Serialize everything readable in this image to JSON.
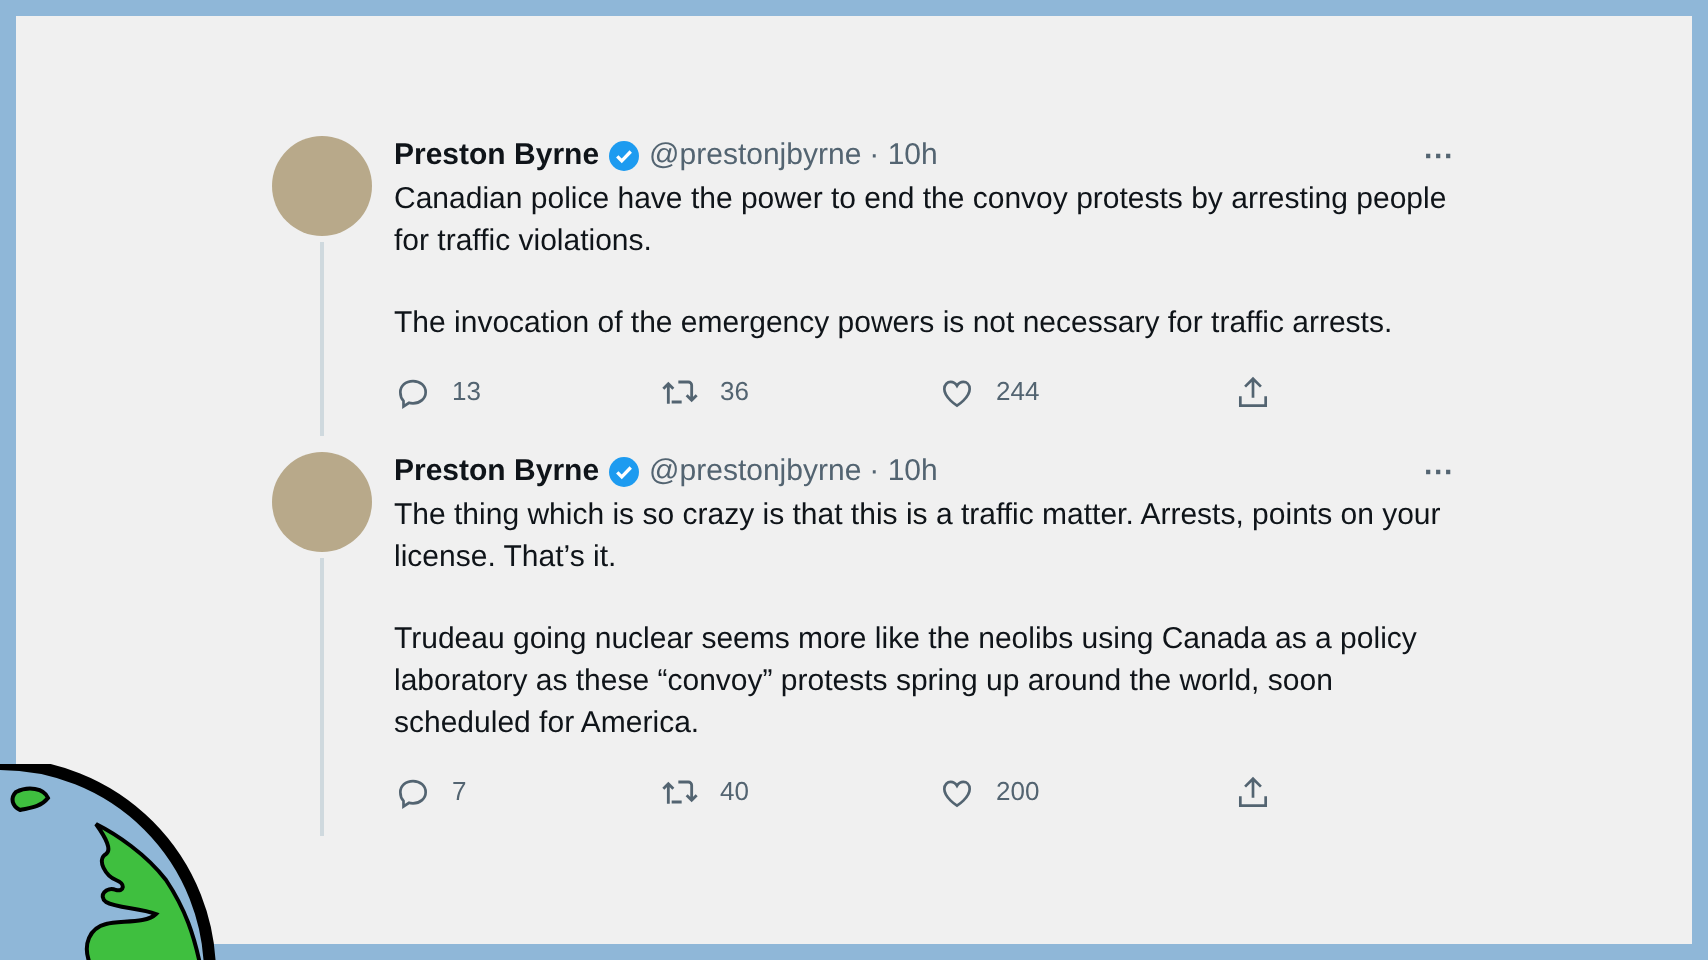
{
  "tweets": [
    {
      "name": "Preston Byrne",
      "verified": true,
      "handle": "@prestonjbyrne",
      "time": "· 10h",
      "menu": "···",
      "thread_line": true,
      "paragraphs": [
        "Canadian police have the power to end the convoy protests by arresting people for traffic violations.",
        "The invocation of the emergency powers is not necessary for traffic arrests."
      ],
      "replies": "13",
      "retweets": "36",
      "likes": "244"
    },
    {
      "name": "Preston Byrne",
      "verified": true,
      "handle": "@prestonjbyrne",
      "time": "· 10h",
      "menu": "···",
      "thread_line": true,
      "paragraphs": [
        "The thing which is so crazy is that this is a traffic matter. Arrests, points on your license. That’s it.",
        "Trudeau going nuclear seems more like the neolibs using Canada as a policy laboratory as these “convoy” protests spring up around the world, soon scheduled for America."
      ],
      "replies": "7",
      "retweets": "40",
      "likes": "200"
    }
  ]
}
